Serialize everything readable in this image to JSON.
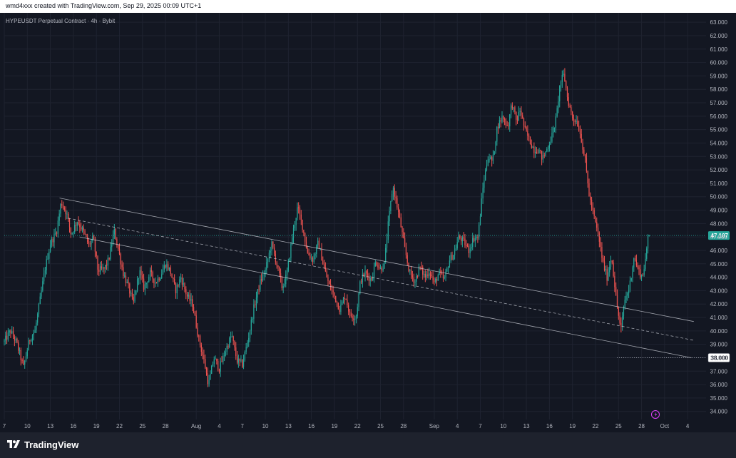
{
  "header": {
    "credit": "wmd4xxx created with TradingView.com, Sep 29, 2025 00:09 UTC+1"
  },
  "footer": {
    "brand": "TradingView"
  },
  "chart_data": {
    "type": "candlestick",
    "title": "HYPEUSDT Perpetual Contract · 4h · Bybit",
    "symbol": "HYPEUSDT",
    "timeframe": "4h",
    "exchange": "Bybit",
    "y_axis": {
      "position": "right",
      "range": [
        33.4,
        63.7
      ],
      "ticks": [
        "34.000",
        "35.000",
        "36.000",
        "37.000",
        "38.000",
        "39.000",
        "40.000",
        "41.000",
        "42.000",
        "43.000",
        "44.000",
        "45.000",
        "46.000",
        "47.000",
        "48.000",
        "49.000",
        "50.000",
        "51.000",
        "52.000",
        "53.000",
        "54.000",
        "55.000",
        "56.000",
        "57.000",
        "58.000",
        "59.000",
        "60.000",
        "61.000",
        "62.000",
        "63.000"
      ]
    },
    "x_axis": {
      "range_days": [
        0,
        91.4
      ],
      "ticks": [
        {
          "label": "7",
          "day": 0
        },
        {
          "label": "10",
          "day": 3
        },
        {
          "label": "13",
          "day": 6
        },
        {
          "label": "16",
          "day": 9
        },
        {
          "label": "19",
          "day": 12
        },
        {
          "label": "22",
          "day": 15
        },
        {
          "label": "25",
          "day": 18
        },
        {
          "label": "28",
          "day": 21
        },
        {
          "label": "Aug",
          "day": 25
        },
        {
          "label": "4",
          "day": 28
        },
        {
          "label": "7",
          "day": 31
        },
        {
          "label": "10",
          "day": 34
        },
        {
          "label": "13",
          "day": 37
        },
        {
          "label": "16",
          "day": 40
        },
        {
          "label": "19",
          "day": 43
        },
        {
          "label": "22",
          "day": 46
        },
        {
          "label": "25",
          "day": 49
        },
        {
          "label": "28",
          "day": 52
        },
        {
          "label": "Sep",
          "day": 56
        },
        {
          "label": "4",
          "day": 59
        },
        {
          "label": "7",
          "day": 62
        },
        {
          "label": "10",
          "day": 65
        },
        {
          "label": "13",
          "day": 68
        },
        {
          "label": "16",
          "day": 71
        },
        {
          "label": "19",
          "day": 74
        },
        {
          "label": "22",
          "day": 77
        },
        {
          "label": "25",
          "day": 80
        },
        {
          "label": "28",
          "day": 83
        },
        {
          "label": "Oct",
          "day": 86
        },
        {
          "label": "4",
          "day": 89
        }
      ]
    },
    "colors": {
      "up": "#26a69a",
      "down": "#ef5350",
      "background": "#131722",
      "grid": "#1f2330",
      "axis_text": "#b2b5be",
      "trend": "#d1d4dc"
    },
    "price_labels": [
      {
        "value": 47.107,
        "text": "47.107",
        "style": "last",
        "color": "#26a69a"
      },
      {
        "value": 38.0,
        "text": "38.000",
        "style": "level",
        "color": "#d1d4dc"
      }
    ],
    "horizontal_levels": [
      {
        "value": 47.107,
        "style": "dotted",
        "color": "#26a69a"
      },
      {
        "value": 38.0,
        "style": "dotted",
        "color": "#d1d4dc",
        "from_day": 79.8
      }
    ],
    "trend_lines": [
      {
        "name": "channel-top",
        "style": "solid",
        "points": [
          [
            7.2,
            49.9
          ],
          [
            89.8,
            40.7
          ]
        ]
      },
      {
        "name": "channel-mid",
        "style": "dashed",
        "points": [
          [
            8.3,
            48.4
          ],
          [
            89.8,
            39.3
          ]
        ]
      },
      {
        "name": "channel-bottom",
        "style": "solid",
        "points": [
          [
            9.8,
            47.0
          ],
          [
            89.5,
            38.0
          ]
        ]
      }
    ],
    "price_path": [
      [
        0.0,
        39.2
      ],
      [
        0.8,
        40.0
      ],
      [
        1.6,
        39.1
      ],
      [
        2.5,
        37.3
      ],
      [
        3.3,
        39.4
      ],
      [
        4.0,
        40.0
      ],
      [
        4.6,
        42.1
      ],
      [
        5.3,
        44.6
      ],
      [
        6.0,
        46.5
      ],
      [
        6.8,
        47.4
      ],
      [
        7.4,
        49.6
      ],
      [
        8.1,
        48.8
      ],
      [
        8.7,
        47.2
      ],
      [
        9.5,
        48.2
      ],
      [
        10.3,
        47.4
      ],
      [
        11.0,
        46.4
      ],
      [
        11.6,
        46.9
      ],
      [
        12.2,
        44.5
      ],
      [
        13.0,
        44.6
      ],
      [
        13.6,
        45.3
      ],
      [
        14.3,
        47.5
      ],
      [
        14.8,
        46.2
      ],
      [
        15.5,
        44.3
      ],
      [
        16.2,
        43.2
      ],
      [
        16.8,
        42.0
      ],
      [
        17.6,
        44.5
      ],
      [
        18.2,
        43.2
      ],
      [
        19.0,
        44.3
      ],
      [
        19.7,
        43.6
      ],
      [
        20.4,
        44.2
      ],
      [
        21.0,
        45.0
      ],
      [
        21.6,
        44.5
      ],
      [
        22.3,
        43.0
      ],
      [
        23.0,
        44.0
      ],
      [
        23.8,
        42.6
      ],
      [
        24.5,
        42.0
      ],
      [
        25.3,
        39.5
      ],
      [
        26.0,
        37.8
      ],
      [
        26.6,
        36.0
      ],
      [
        27.3,
        38.0
      ],
      [
        28.0,
        37.2
      ],
      [
        28.8,
        38.5
      ],
      [
        29.6,
        39.7
      ],
      [
        30.3,
        37.8
      ],
      [
        31.0,
        37.5
      ],
      [
        31.8,
        39.5
      ],
      [
        32.5,
        41.7
      ],
      [
        33.3,
        43.6
      ],
      [
        34.0,
        44.5
      ],
      [
        34.8,
        46.5
      ],
      [
        35.4,
        45.2
      ],
      [
        36.2,
        43.2
      ],
      [
        36.8,
        44.2
      ],
      [
        37.5,
        47.0
      ],
      [
        38.2,
        49.2
      ],
      [
        38.8,
        47.9
      ],
      [
        39.5,
        45.8
      ],
      [
        40.2,
        45.3
      ],
      [
        40.9,
        46.6
      ],
      [
        41.6,
        44.8
      ],
      [
        42.3,
        43.4
      ],
      [
        43.0,
        42.6
      ],
      [
        43.7,
        41.6
      ],
      [
        44.4,
        42.7
      ],
      [
        45.0,
        41.2
      ],
      [
        45.8,
        41.0
      ],
      [
        46.4,
        43.8
      ],
      [
        47.0,
        44.3
      ],
      [
        47.8,
        43.8
      ],
      [
        48.4,
        45.2
      ],
      [
        49.0,
        44.6
      ],
      [
        49.5,
        45.0
      ],
      [
        50.0,
        47.9
      ],
      [
        50.6,
        50.8
      ],
      [
        51.1,
        49.5
      ],
      [
        51.6,
        48.0
      ],
      [
        52.2,
        46.0
      ],
      [
        52.8,
        44.3
      ],
      [
        53.5,
        43.7
      ],
      [
        54.1,
        44.8
      ],
      [
        54.8,
        44.0
      ],
      [
        55.4,
        44.5
      ],
      [
        56.0,
        43.5
      ],
      [
        56.6,
        44.3
      ],
      [
        57.3,
        43.8
      ],
      [
        58.0,
        45.3
      ],
      [
        58.6,
        45.8
      ],
      [
        59.2,
        47.0
      ],
      [
        59.9,
        46.6
      ],
      [
        60.5,
        46.0
      ],
      [
        61.1,
        46.9
      ],
      [
        61.7,
        47.0
      ],
      [
        62.4,
        51.0
      ],
      [
        63.0,
        53.0
      ],
      [
        63.6,
        52.6
      ],
      [
        64.2,
        55.2
      ],
      [
        64.9,
        56.0
      ],
      [
        65.6,
        55.2
      ],
      [
        66.1,
        57.0
      ],
      [
        66.7,
        55.6
      ],
      [
        67.2,
        56.5
      ],
      [
        67.8,
        55.0
      ],
      [
        68.4,
        54.2
      ],
      [
        69.0,
        53.5
      ],
      [
        69.6,
        53.5
      ],
      [
        70.1,
        52.8
      ],
      [
        70.7,
        53.6
      ],
      [
        71.3,
        54.5
      ],
      [
        71.9,
        55.9
      ],
      [
        72.4,
        58.5
      ],
      [
        72.9,
        59.1
      ],
      [
        73.4,
        57.2
      ],
      [
        74.0,
        55.9
      ],
      [
        74.6,
        55.6
      ],
      [
        75.1,
        54.5
      ],
      [
        75.7,
        52.5
      ],
      [
        76.2,
        50.0
      ],
      [
        76.8,
        48.5
      ],
      [
        77.4,
        47.0
      ],
      [
        78.0,
        45.0
      ],
      [
        78.5,
        44.0
      ],
      [
        79.1,
        45.6
      ],
      [
        79.7,
        42.3
      ],
      [
        80.3,
        40.0
      ],
      [
        80.8,
        42.3
      ],
      [
        81.4,
        43.2
      ],
      [
        82.0,
        45.5
      ],
      [
        82.6,
        44.5
      ],
      [
        83.1,
        44.0
      ],
      [
        83.7,
        46.0
      ],
      [
        84.0,
        47.1
      ]
    ]
  }
}
